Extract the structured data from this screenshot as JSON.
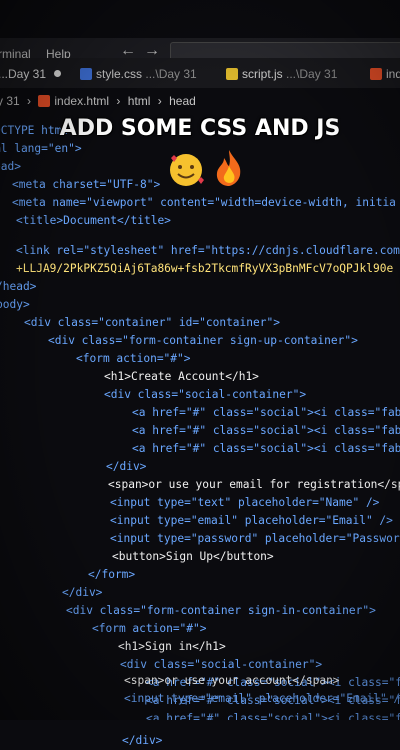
{
  "menubar": {
    "items": [
      "rminal",
      "Help"
    ],
    "back_icon": "arrow-left",
    "forward_icon": "arrow-right"
  },
  "tabs": [
    {
      "name": "...Day 31",
      "modified": true
    },
    {
      "name": "style.css",
      "dir": "...\\Day 31",
      "icon": "css-file-icon"
    },
    {
      "name": "script.js",
      "dir": "...\\Day 31",
      "icon": "js-file-icon"
    },
    {
      "name": "ind",
      "icon": "html-file-icon"
    }
  ],
  "breadcrumb": [
    "y 31",
    "index.html",
    "html",
    "head"
  ],
  "caption": {
    "text": "ADD SOME CSS AND JS",
    "emojis": "🥰🔥"
  },
  "code": {
    "l01": "OCTYPE html>",
    "l02": "ml lang=\"en\">",
    "l03": "ead>",
    "l04a": "<meta charset=\"UTF-8\">",
    "l05a": "<meta name=\"viewport\" content=\"width=device-width, initia",
    "l06a": "<title>Document</title>",
    "l07a": "<link rel=\"stylesheet\" href=\"https://cdnjs.cloudflare.com",
    "l08a": "+LLJA9/2PkPKZ5QiAj6Ta86w+fsb2TkcmfRyVX3pBnMFcV7oQPJkl90e",
    "l09a": "/head>",
    "l10a": "body>",
    "l11a": "<div class=\"container\" id=\"container\">",
    "l12a": "<div class=\"form-container sign-up-container\">",
    "l13a": "<form action=\"#\">",
    "l14a": "<h1>Create Account</h1>",
    "l15a": "<div class=\"social-container\">",
    "l16a": "<a href=\"#\" class=\"social\"><i class=\"fab",
    "l17a": "<a href=\"#\" class=\"social\"><i class=\"fab",
    "l18a": "<a href=\"#\" class=\"social\"><i class=\"fab",
    "l19a": "</div>",
    "l20a": "<span>or use your email for registration</spa",
    "l21a": "<input type=\"text\" placeholder=\"Name\" />",
    "l22a": "<input type=\"email\" placeholder=\"Email\" />",
    "l23a": "<input type=\"password\" placeholder=\"Passwor",
    "l24a": "<button>Sign Up</button>",
    "l25a": "</form>",
    "l26a": "</div>",
    "l27a": "<div class=\"form-container sign-in-container\">",
    "l28a": "<form action=\"#\">",
    "l29a": "<h1>Sign in</h1>",
    "l30a": "<div class=\"social-container\">",
    "l31a": "<a href=\"#\" class=\"social\"><i class=\"fa",
    "l32a": "<a href=\"#\" class=\"social\"><i class=\"fa",
    "l33a": "<a href=\"#\" class=\"social\"><i class=\"fa",
    "l34a": "</div>",
    "l35a": "<span>or use your account</span>",
    "l36a": "<input type=\"email\" placeholder=\"Email\" />"
  },
  "colors": {
    "tag": "#6aa7ff",
    "attr": "#ff8ad8",
    "string": "#ffe37a",
    "background": "#0b0b0f"
  }
}
